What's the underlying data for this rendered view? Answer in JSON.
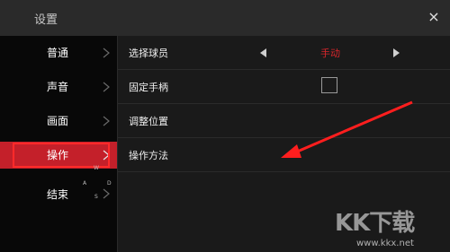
{
  "header": {
    "title": "设置",
    "close_label": "×"
  },
  "sidebar": {
    "items": [
      {
        "label": "普通"
      },
      {
        "label": "声音"
      },
      {
        "label": "画面"
      },
      {
        "label": "操作"
      },
      {
        "label": "结束"
      }
    ],
    "active_index": 3,
    "key_hints": [
      "W",
      "A",
      "D",
      "S"
    ]
  },
  "settings": {
    "rows": [
      {
        "label": "选择球员",
        "value": "手动"
      },
      {
        "label": "固定手柄"
      },
      {
        "label": "调整位置"
      },
      {
        "label": "操作方法"
      }
    ]
  },
  "watermark": {
    "logo": "KK下载",
    "url": "www.kkx.net"
  },
  "colors": {
    "accent": "#d7262b",
    "highlight": "#ff2a2a",
    "sidebar_bg": "#080808",
    "content_bg": "#1a1a1a"
  }
}
